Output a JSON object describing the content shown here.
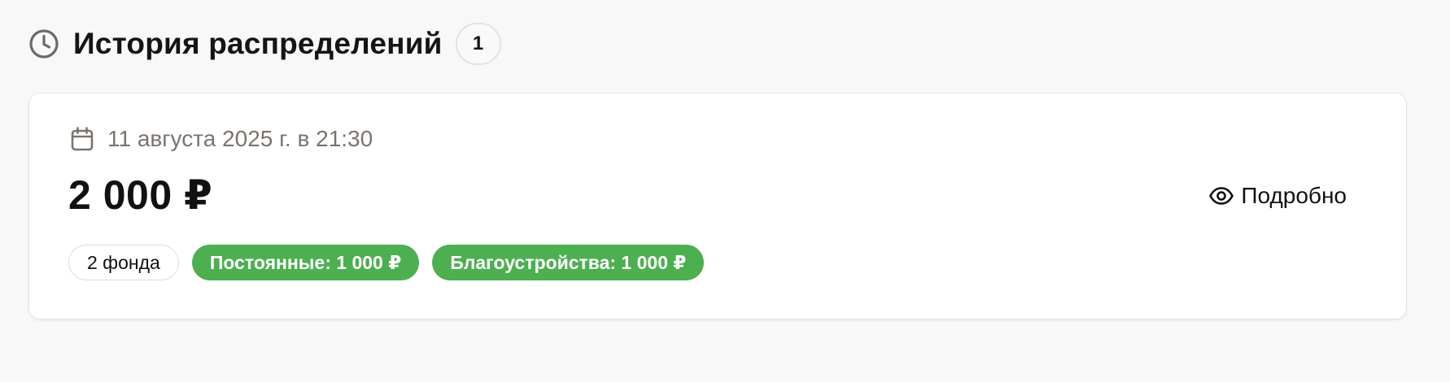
{
  "header": {
    "icon": "clock-icon",
    "title": "История распределений",
    "count": "1"
  },
  "distribution": {
    "date_icon": "calendar-icon",
    "date": "11 августа 2025 г. в 21:30",
    "amount": "2 000 ₽",
    "chips": [
      {
        "label": "2 фонда",
        "style": "outline"
      },
      {
        "label": "Постоянные: 1 000 ₽",
        "style": "green"
      },
      {
        "label": "Благоустройства: 1 000 ₽",
        "style": "green"
      }
    ],
    "details_button": {
      "icon": "eye-icon",
      "label": "Подробно"
    }
  },
  "colors": {
    "background": "#f8f8f8",
    "card": "#ffffff",
    "accent_green": "#4caf50",
    "muted_text": "#7a746e",
    "icon_gray": "#6f6a66"
  }
}
